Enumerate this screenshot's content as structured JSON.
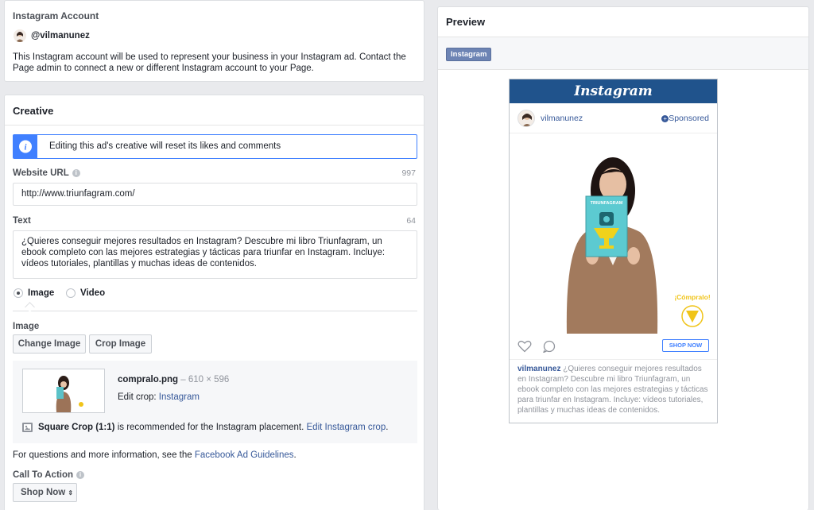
{
  "account": {
    "heading": "Instagram Account",
    "handle": "@vilmanunez",
    "description": "This Instagram account will be used to represent your business in your Instagram ad. Contact the Page admin to connect a new or different Instagram account to your Page."
  },
  "creative": {
    "heading": "Creative",
    "notice": "Editing this ad's creative will reset its likes and comments",
    "website_url_label": "Website URL",
    "website_url_count": "997",
    "website_url_value": "http://www.triunfagram.com/",
    "text_label": "Text",
    "text_count": "64",
    "text_value": "¿Quieres conseguir mejores resultados en Instagram? Descubre mi libro Triunfagram, un ebook completo con las mejores estrategias y tácticas para triunfar en Instagram. Incluye: vídeos tutoriales, plantillas y muchas ideas de contenidos.",
    "media_tabs": [
      "Image",
      "Video"
    ],
    "image_label": "Image",
    "change_image": "Change Image",
    "crop_image": "Crop Image",
    "file_name": "compralo.png",
    "file_dims": "– 610 × 596",
    "edit_crop_label": "Edit crop:",
    "edit_crop_link": "Instagram",
    "square_crop_bold": "Square Crop (1:1)",
    "square_crop_text": "is recommended for the Instagram placement.",
    "square_crop_link": "Edit Instagram crop",
    "square_crop_end": ".",
    "guidelines_text": "For questions and more information, see the",
    "guidelines_link": "Facebook Ad Guidelines",
    "guidelines_end": ".",
    "cta_label": "Call To Action",
    "cta_value": "Shop Now"
  },
  "preview": {
    "heading": "Preview",
    "placement_badge": "Instagram",
    "brand": "Instagram",
    "username": "vilmanunez",
    "sponsored": "Sponsored",
    "book_title": "TRIUNFAGRAM",
    "cta_overlay": "¡Cómpralo!",
    "shop_now": "SHOP NOW",
    "caption_user": "vilmanunez",
    "caption_text": "¿Quieres conseguir mejores resultados en Instagram? Descubre mi libro Triunfagram, un ebook completo con las mejores estrategias y tácticas para triunfar en Instagram. Incluye: vídeos tutoriales, plantillas y muchas ideas de contenidos."
  },
  "icons": [
    "avatar",
    "info-icon",
    "radio-icon",
    "image-icon",
    "heart-icon",
    "comment-icon",
    "plus-circle-icon",
    "chevron-updown-icon"
  ]
}
